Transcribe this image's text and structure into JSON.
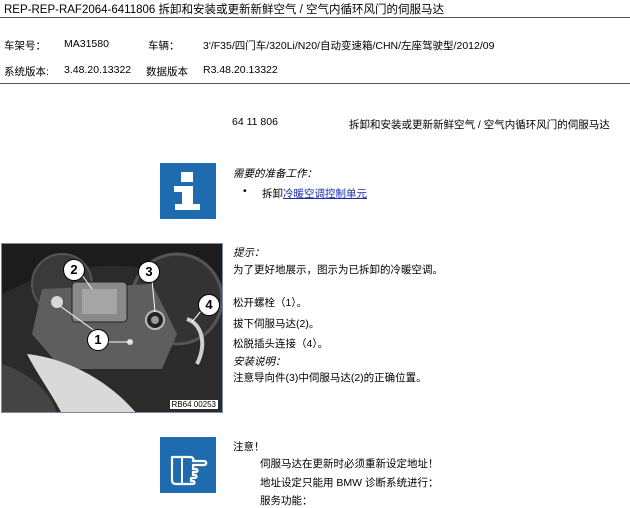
{
  "header": {
    "title": "REP-REP-RAF2064-6411806  拆卸和安装或更新新鲜空气 / 空气内循环风门的伺服马达"
  },
  "info": {
    "chassis_label": "车架号：",
    "chassis_value": "MA31580",
    "vehicle_label": "车辆：",
    "vehicle_value": "3'/F35/四门车/320Li/N20/自动变速箱/CHN/左座驾驶型/2012/09",
    "sysver_label": "系统版本:",
    "sysver_value": "3.48.20.13322",
    "dataver_label": "数据版本",
    "dataver_value": "R3.48.20.13322"
  },
  "doc": {
    "number": "64 11 806",
    "title": "拆卸和安装或更新新鲜空气 / 空气内循环风门的伺服马达"
  },
  "prep": {
    "heading": "需要的准备工作：",
    "bullet": "•",
    "item_prefix": "拆卸",
    "item_link": "冷暖空调控制单元"
  },
  "figure": {
    "code": "RB64 00253",
    "callouts": [
      "1",
      "2",
      "3",
      "4"
    ]
  },
  "hint": {
    "heading": "提示：",
    "text": "为了更好地展示，图示为已拆卸的冷暖空调。"
  },
  "steps": [
    "松开螺栓（1）。",
    "拔下伺服马达(2)。",
    "松脱插头连接（4）。"
  ],
  "install": {
    "heading": "安装说明：",
    "text": "注意导向件(3)中伺服马达(2)的正确位置。"
  },
  "caution": {
    "heading": "注意！",
    "line1": "伺服马达在更新时必须重新设定地址！",
    "line2": "地址设定只能用 BMW 诊断系统进行：",
    "line3": "服务功能："
  },
  "colors": {
    "icon_blue": "#1f6bb0",
    "link": "#1a2aa8"
  },
  "icons": {
    "info": "info-icon",
    "caution": "pointing-hand-icon"
  }
}
